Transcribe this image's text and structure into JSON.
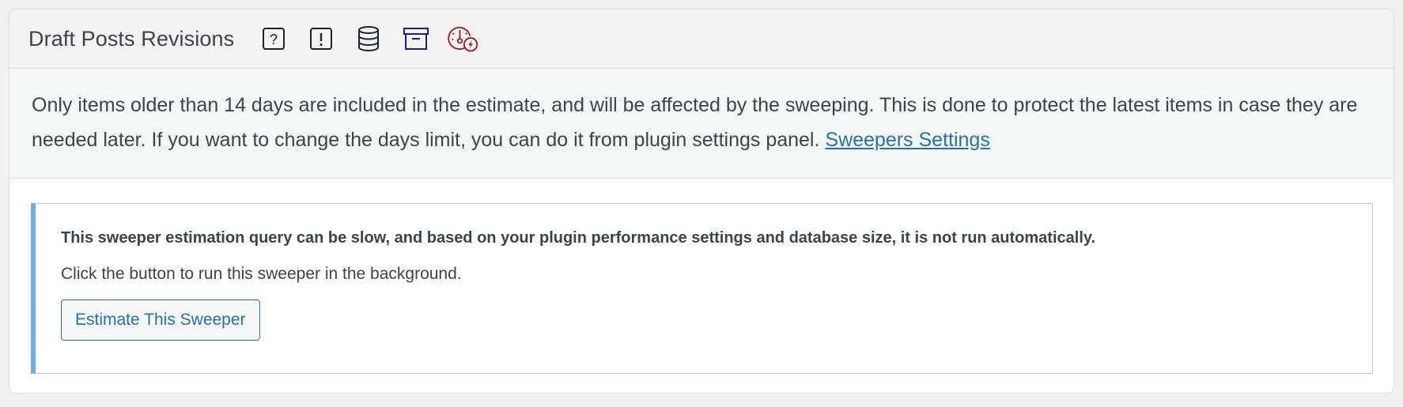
{
  "panel": {
    "title": "Draft Posts Revisions",
    "icons": [
      {
        "name": "help-icon",
        "color": "#1d2327"
      },
      {
        "name": "warning-icon",
        "color": "#1d2327"
      },
      {
        "name": "database-icon",
        "color": "#1d2327"
      },
      {
        "name": "archive-icon",
        "color": "#1d1d8f"
      },
      {
        "name": "speed-gauge-icon",
        "color": "#a0161b"
      }
    ]
  },
  "intro": {
    "text": "Only items older than 14 days are included in the estimate, and will be affected by the sweeping. This is done to protect the latest items in case they are needed later. If you want to change the days limit, you can do it from plugin settings panel.",
    "link_label": "Sweepers Settings"
  },
  "notice": {
    "strong_text": "This sweeper estimation query can be slow, and based on your plugin performance settings and database size, it is not run automatically.",
    "text": "Click the button to run this sweeper in the background.",
    "button_label": "Estimate This Sweeper",
    "accent_color": "#72aee6"
  }
}
